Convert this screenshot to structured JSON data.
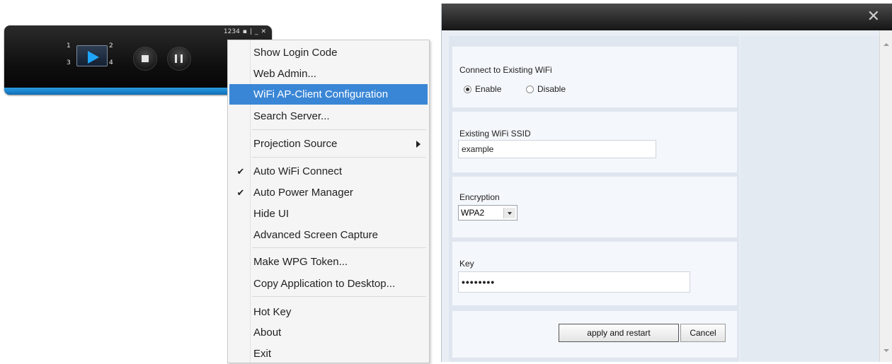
{
  "player": {
    "code_label": "1234",
    "quadrant_numbers": [
      "1",
      "2",
      "3",
      "4"
    ]
  },
  "menu": {
    "items": [
      {
        "label": "Show Login Code"
      },
      {
        "label": "Web Admin..."
      },
      {
        "label": "WiFi AP-Client Configuration",
        "highlighted": true
      },
      {
        "label": "Search Server..."
      },
      {
        "label": "Projection Source",
        "submenu": true
      },
      {
        "label": "Auto WiFi Connect",
        "checked": true
      },
      {
        "label": "Auto Power Manager",
        "checked": true
      },
      {
        "label": "Hide UI"
      },
      {
        "label": "Advanced Screen Capture"
      },
      {
        "label": "Make WPG Token..."
      },
      {
        "label": "Copy Application to Desktop..."
      },
      {
        "label": "Hot Key"
      },
      {
        "label": "About"
      },
      {
        "label": "Exit"
      }
    ]
  },
  "dialog": {
    "close_glyph": "✕",
    "connect": {
      "label": "Connect to Existing WiFi",
      "enable_label": "Enable",
      "disable_label": "Disable",
      "selected": "Enable"
    },
    "ssid": {
      "label": "Existing WiFi SSID",
      "value": "example"
    },
    "encryption": {
      "label": "Encryption",
      "value": "WPA2"
    },
    "key": {
      "label": "Key",
      "value": "••••••••"
    },
    "apply_label": "apply and restart",
    "cancel_label": "Cancel"
  },
  "colors": {
    "menu_highlight": "#3a86d6",
    "player_accent": "#1ea6ff"
  }
}
